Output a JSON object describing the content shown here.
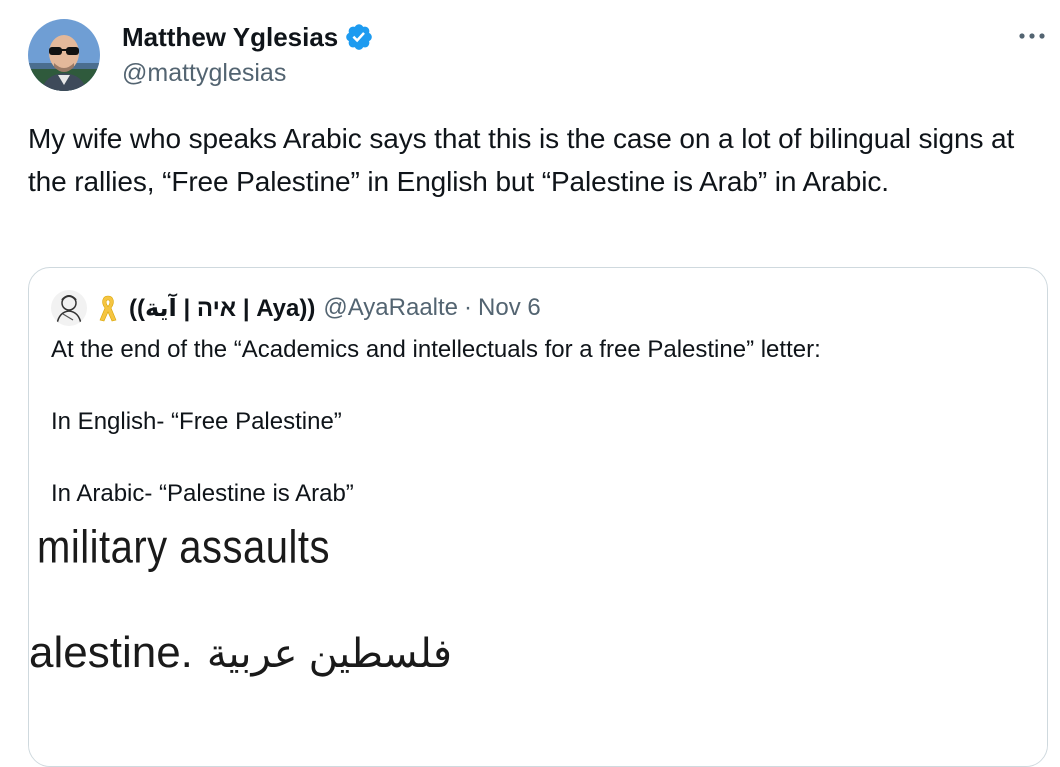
{
  "author": {
    "name": "Matthew Yglesias",
    "handle": "@mattyglesias",
    "verified_icon": "verified-badge-icon",
    "avatar_icon": "avatar-photo"
  },
  "more_icon": "more-horizontal-icon",
  "tweet": {
    "text": "My wife who speaks Arabic says that this is the case on a lot of bilingual signs at the rallies, “Free Palestine” in English but “Palestine is Arab” in Arabic."
  },
  "quoted": {
    "avatar_icon": "avatar-sketch",
    "ribbon_icon": "yellow-ribbon-icon",
    "name": "((איה | آية | Aya))",
    "handle": "@AyaRaalte",
    "dot": "·",
    "date": "Nov 6",
    "lines": [
      "At the end of the “Academics and intellectuals for a free Palestine” letter:",
      "In English- “Free Palestine”",
      "In Arabic- “Palestine is Arab”"
    ],
    "media": {
      "line1": "military assaults",
      "line2_en": "alestine.",
      "line2_ar": "فلسطين عربية"
    }
  },
  "colors": {
    "text": "#0f1419",
    "secondary": "#536471",
    "verified": "#1d9bf0",
    "border": "#cfd9de",
    "ribbon": "#f5c542"
  }
}
